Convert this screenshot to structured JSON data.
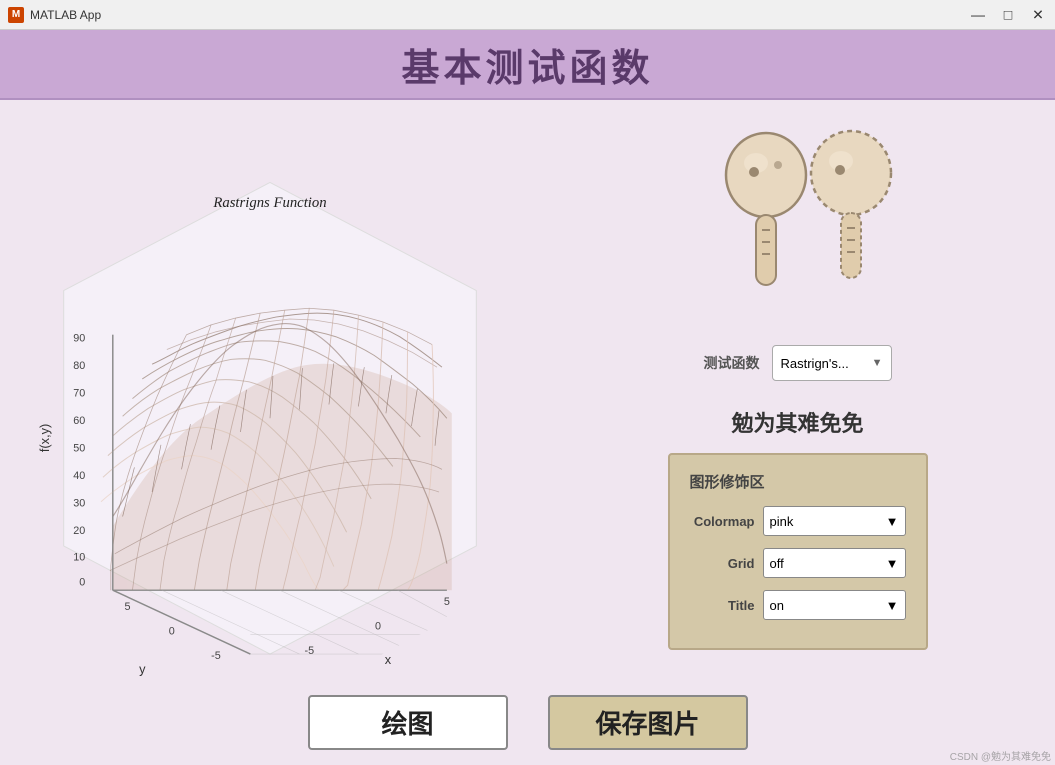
{
  "titleBar": {
    "appName": "MATLAB App",
    "icon": "M",
    "minimizeLabel": "—",
    "maximizeLabel": "□",
    "closeLabel": "✕"
  },
  "header": {
    "title": "基本测试函数"
  },
  "chart": {
    "title": "Rastrigns Function",
    "xLabel": "x",
    "yLabel": "y",
    "zLabel": "f(x,y)",
    "yAxisValues": [
      "0",
      "10",
      "20",
      "30",
      "40",
      "50",
      "60",
      "70",
      "80",
      "90"
    ]
  },
  "rightPanel": {
    "functionSelectorLabel": "测试函数",
    "functionDropdownValue": "Rastrign's...",
    "slogan": "勉为其难免免",
    "decorationBox": {
      "title": "图形修饰区",
      "colormap": {
        "label": "Colormap",
        "value": "pink"
      },
      "grid": {
        "label": "Grid",
        "value": "off"
      },
      "title_opt": {
        "label": "Title",
        "value": "on"
      }
    }
  },
  "buttons": {
    "plot": "绘图",
    "save": "保存图片"
  },
  "watermark": "CSDN @勉为其难免免"
}
